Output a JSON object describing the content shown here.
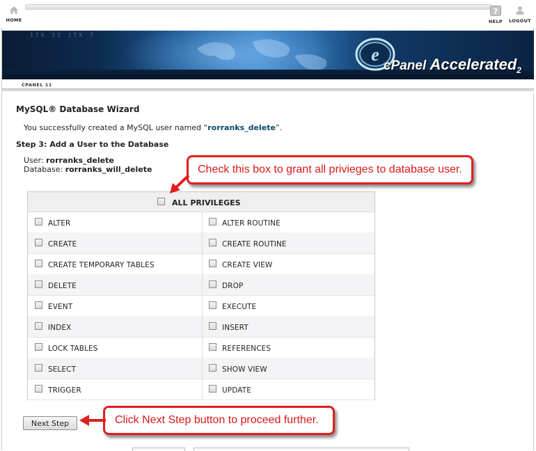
{
  "nav": {
    "home_label": "HOME",
    "help_label": "HELP",
    "logout_label": "LOGOUT"
  },
  "banner": {
    "logo_prefix": "cPanel",
    "logo_main": "Accelerated",
    "logo_version": "2",
    "code_text": "1TX  32  1TX  7"
  },
  "tab": {
    "label": "CPANEL 11"
  },
  "wizard": {
    "title": "MySQL® Database Wizard",
    "success_prefix": "You successfully created a MySQL user named “",
    "success_user": "rorranks_delete",
    "success_suffix": "”.",
    "step_title": "Step 3: Add a User to the Database",
    "user_label": "User:",
    "user_value": "rorranks_delete",
    "db_label": "Database:",
    "db_value": "rorranks_will_delete"
  },
  "privileges": {
    "all_label": "ALL PRIVILEGES",
    "items": [
      "ALTER",
      "ALTER ROUTINE",
      "CREATE",
      "CREATE ROUTINE",
      "CREATE TEMPORARY TABLES",
      "CREATE VIEW",
      "DELETE",
      "DROP",
      "EVENT",
      "EXECUTE",
      "INDEX",
      "INSERT",
      "LOCK TABLES",
      "REFERENCES",
      "SELECT",
      "SHOW VIEW",
      "TRIGGER",
      "UPDATE"
    ]
  },
  "next_button": "Next Step",
  "callouts": {
    "all_privileges": "Check this box to grant all privieges to database user.",
    "next_step": "Click Next Step button to proceed further."
  },
  "colors": {
    "callout_red": "#e01e1e",
    "username_blue": "#0b4a6b",
    "banner_blue": "#1c5a96"
  }
}
